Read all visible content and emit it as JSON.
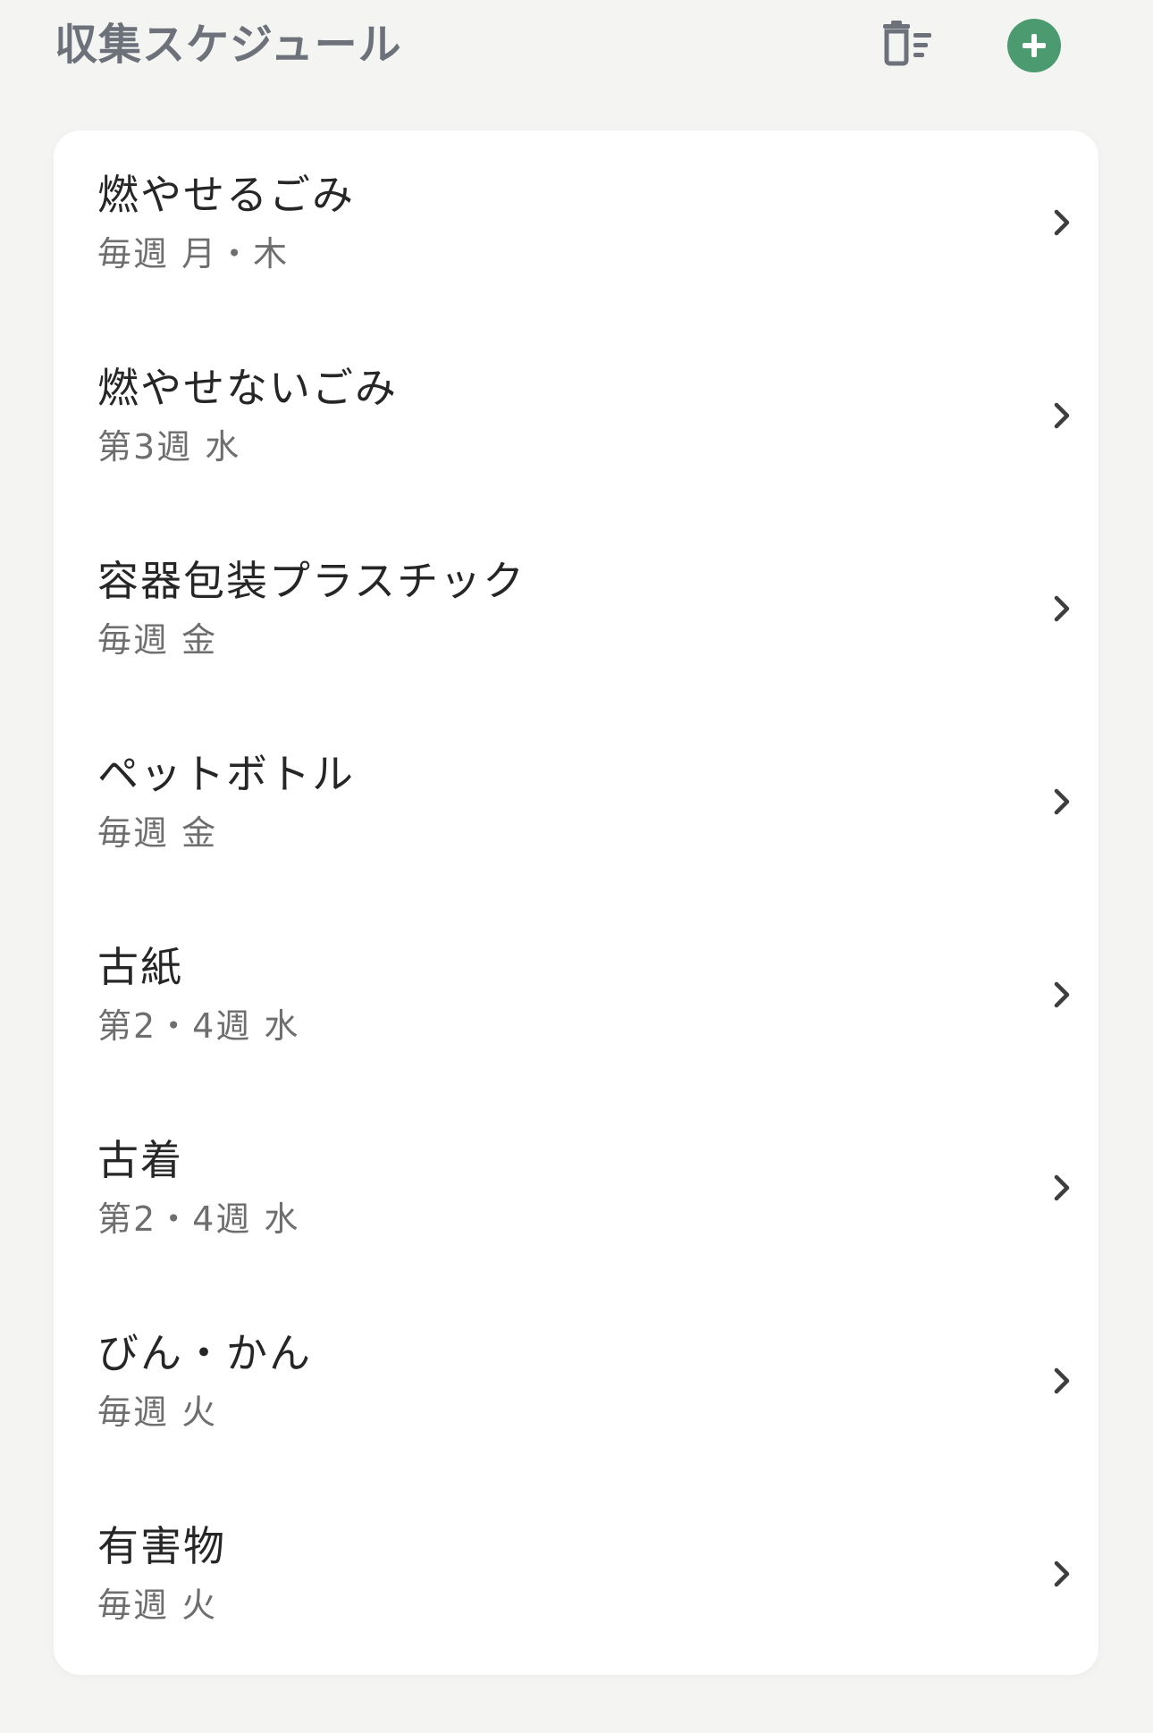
{
  "header": {
    "title": "収集スケジュール",
    "delete_icon": "delete-list-icon",
    "add_icon": "plus-circle-icon"
  },
  "colors": {
    "background": "#f4f5f3",
    "title": "#6d727a",
    "accent": "#4c9a6f",
    "icon": "#6d727a",
    "chevron": "#3d3d3d"
  },
  "items": [
    {
      "name": "燃やせるごみ",
      "schedule": "毎週 月・木"
    },
    {
      "name": "燃やせないごみ",
      "schedule": "第3週 水"
    },
    {
      "name": "容器包装プラスチック",
      "schedule": "毎週 金"
    },
    {
      "name": "ペットボトル",
      "schedule": "毎週 金"
    },
    {
      "name": "古紙",
      "schedule": "第2・4週 水"
    },
    {
      "name": "古着",
      "schedule": "第2・4週 水"
    },
    {
      "name": "びん・かん",
      "schedule": "毎週 火"
    },
    {
      "name": "有害物",
      "schedule": "毎週 火"
    }
  ]
}
